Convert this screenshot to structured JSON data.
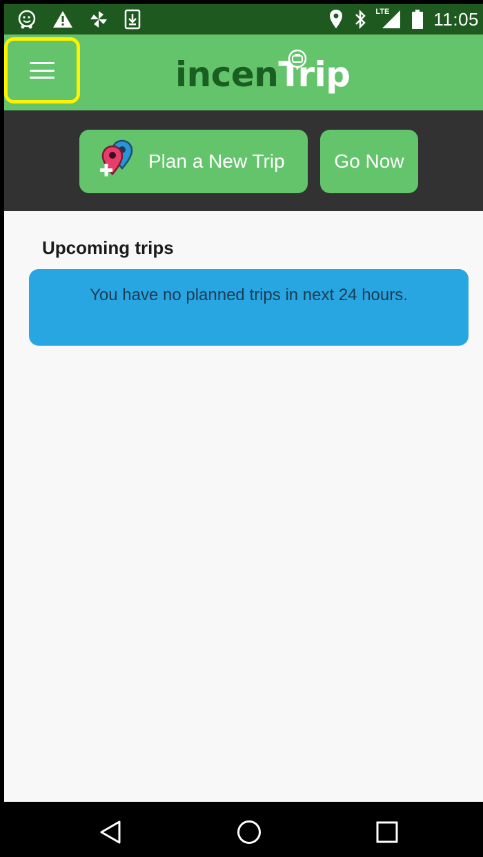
{
  "status_bar": {
    "time": "11:05",
    "icons": [
      "waze-icon",
      "warning-icon",
      "pinwheel-icon",
      "download-icon",
      "location-icon",
      "bluetooth-icon",
      "lte-signal-icon",
      "battery-icon"
    ],
    "lte_label": "LTE"
  },
  "app_bar": {
    "logo_part1": "incen",
    "logo_part2": "Trip",
    "menu_icon": "hamburger-menu-icon"
  },
  "actions": {
    "plan_label": "Plan a New Trip",
    "go_label": "Go Now"
  },
  "upcoming": {
    "title": "Upcoming trips",
    "empty_message": "You have no planned trips in next 24 hours."
  },
  "nav": {
    "back_icon": "back-triangle-icon",
    "home_icon": "home-circle-icon",
    "recents_icon": "recents-square-icon"
  },
  "colors": {
    "status_bar": "#1e5a20",
    "app_green": "#63c46b",
    "logo_dark": "#1a5e22",
    "strip": "#323232",
    "card_blue": "#27a6e1",
    "highlight": "#fff200"
  }
}
